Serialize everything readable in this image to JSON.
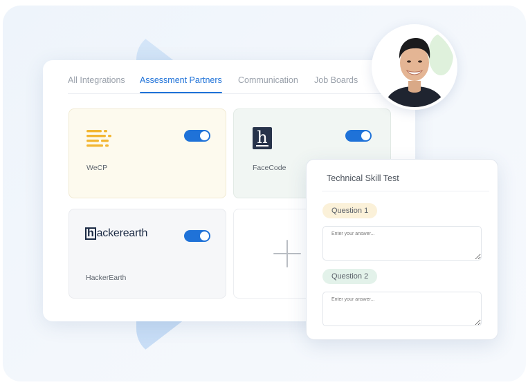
{
  "tabs": [
    {
      "label": "All Integrations",
      "active": false
    },
    {
      "label": "Assessment Partners",
      "active": true
    },
    {
      "label": "Communication",
      "active": false
    },
    {
      "label": "Job Boards",
      "active": false
    }
  ],
  "integrations": {
    "wecp": {
      "name": "WeCP",
      "enabled": true
    },
    "facecode": {
      "name": "FaceCode",
      "logo_letter": "h",
      "enabled": true
    },
    "hackerearth": {
      "name": "HackerEarth",
      "logo_letter": "h",
      "logo_text": "ackerearth",
      "enabled": true
    }
  },
  "test": {
    "title": "Technical Skill Test",
    "questions": [
      {
        "label": "Question 1",
        "placeholder": "Enter your answer..."
      },
      {
        "label": "Question 2",
        "placeholder": "Enter your answer..."
      }
    ]
  },
  "colors": {
    "accent": "#1f72d8",
    "wecp_logo": "#f2b632",
    "hackerearth_logo": "#1b2a44",
    "facecode_logo_bg": "#27334a"
  }
}
